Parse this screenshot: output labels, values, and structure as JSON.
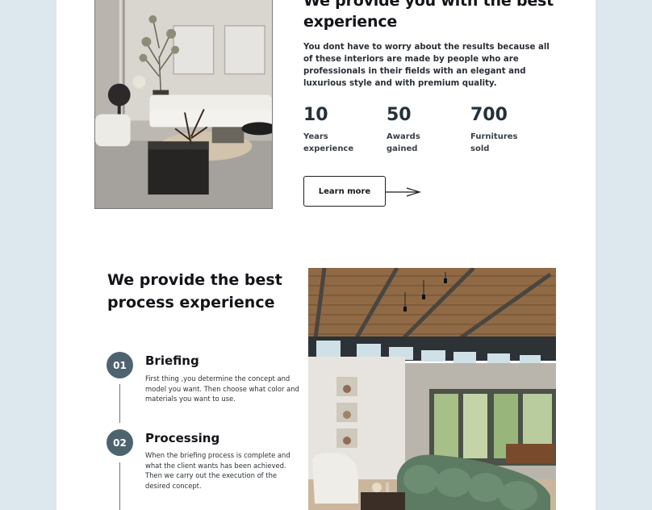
{
  "about": {
    "title": "We provide you with the best experience",
    "description": "You dont have to worry about the results because all of these interiors are made by people who are professionals in their fields with an elegant and luxurious style and with premium quality.",
    "stats": [
      {
        "value": "10",
        "label": "Years experience"
      },
      {
        "value": "50",
        "label": "Awards gained"
      },
      {
        "value": "700",
        "label": "Furnitures sold"
      }
    ],
    "cta_label": "Learn more",
    "arrow_icon": "arrow-right-icon"
  },
  "process": {
    "title": "We provide the best process experience",
    "steps": [
      {
        "number": "01",
        "title": "Briefing",
        "description": "First thing ,you determine the concept and model you want. Then choose what color and materials you want to use."
      },
      {
        "number": "02",
        "title": "Processing",
        "description": "When the briefing process is complete and what the client wants has been achieved. Then we carry out the execution of the desired concept."
      }
    ]
  },
  "colors": {
    "page_background": "#dce7ee",
    "card_background": "#ffffff",
    "step_badge": "#4e6370",
    "text_dark": "#121418"
  }
}
